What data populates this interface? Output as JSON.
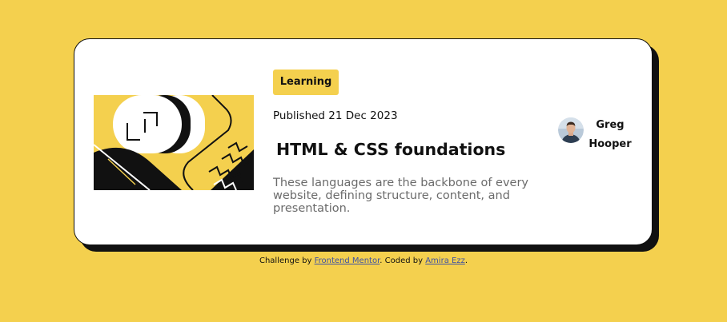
{
  "card": {
    "category_tag": "Learning",
    "published": "Published 21 Dec 2023",
    "title": "HTML & CSS foundations",
    "description": "These languages are the backbone of every website, defining structure, content, and presentation.",
    "author": {
      "name_line1": "Greg",
      "name_line2": "Hooper"
    }
  },
  "footer": {
    "prefix": "Challenge by ",
    "challenge_link": "Frontend Mentor",
    "middle": ". Coded by ",
    "coder_link": "Amira Ezz",
    "suffix": "."
  },
  "colors": {
    "background": "#f4d04e",
    "card": "#ffffff",
    "text": "#111111",
    "muted_text": "#6b6b6b",
    "link": "#3e52a3"
  },
  "icons": {
    "illustration": "abstract-article-illustration",
    "avatar": "author-avatar-photo"
  }
}
